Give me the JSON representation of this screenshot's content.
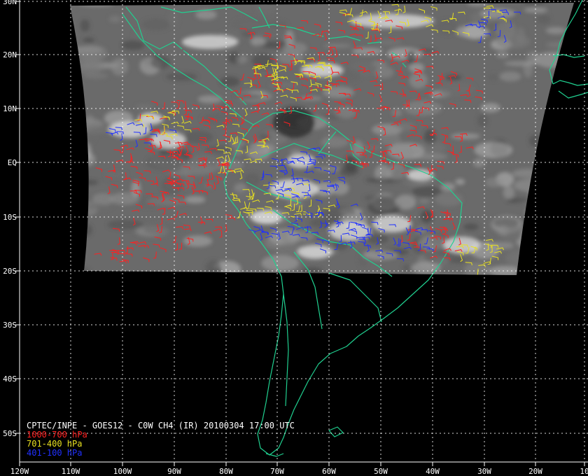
{
  "map": {
    "caption": "CPTEC/INPE - GOES12 - C0W CH4 (IR) 20100304 17:00 UTC",
    "lat_labels": [
      "30N",
      "20N",
      "10N",
      "EQ",
      "10S",
      "20S",
      "30S",
      "40S",
      "50S"
    ],
    "lon_labels": [
      "120W",
      "110W",
      "100W",
      "90W",
      "80W",
      "70W",
      "60W",
      "50W",
      "40W",
      "30W",
      "20W",
      "10"
    ],
    "legend": [
      {
        "label": "1000-700 hPa",
        "color": "#ff2020"
      },
      {
        "label": "701-400 hPa",
        "color": "#e8e020"
      },
      {
        "label": "401-100 hPa",
        "color": "#2030ff"
      }
    ],
    "colors": {
      "background": "#000000",
      "coastline": "#20d090",
      "grid": "#ffffff",
      "satellite_field": "#6a6a6a"
    }
  }
}
